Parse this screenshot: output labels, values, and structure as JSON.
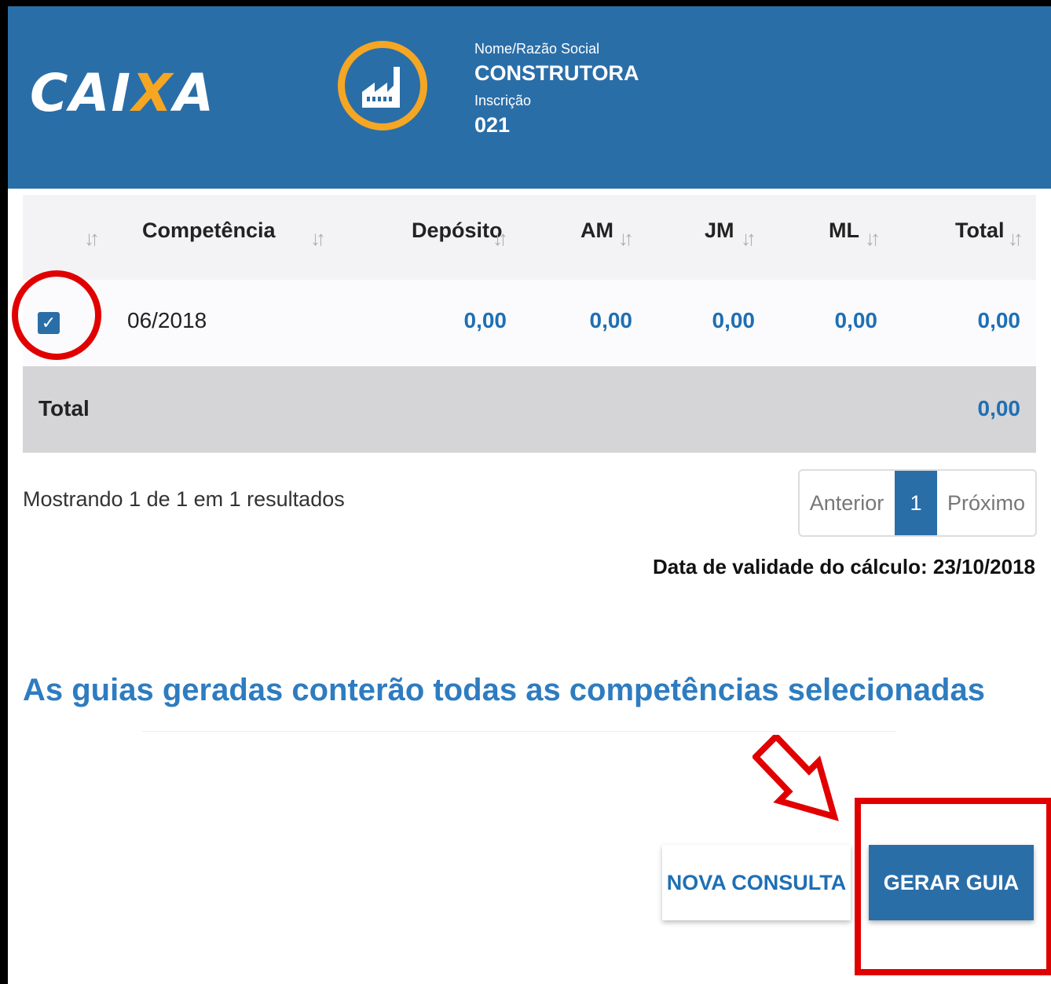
{
  "header": {
    "logo_part1": "CAI",
    "logo_x": "X",
    "logo_part2": "A",
    "name_label": "Nome/Razão Social",
    "name_value": "CONSTRUTORA",
    "inscricao_label": "Inscrição",
    "inscricao_value": "021"
  },
  "table": {
    "columns": [
      "Competência",
      "Depósito",
      "AM",
      "JM",
      "ML",
      "Total"
    ],
    "rows": [
      {
        "selected": true,
        "competencia": "06/2018",
        "deposito": "0,00",
        "am": "0,00",
        "jm": "0,00",
        "ml": "0,00",
        "total": "0,00"
      }
    ],
    "total_label": "Total",
    "total_value": "0,00"
  },
  "pagination": {
    "summary": "Mostrando 1 de 1 em 1 resultados",
    "prev": "Anterior",
    "current": "1",
    "next": "Próximo"
  },
  "validity": "Data de validade do cálculo: 23/10/2018",
  "headline": "As guias geradas conterão todas as competências selecionadas",
  "buttons": {
    "nova_consulta": "NOVA CONSULTA",
    "gerar_guia": "GERAR GUIA"
  },
  "colors": {
    "brand_blue": "#2a6ea8",
    "brand_orange": "#f5a623",
    "value_blue": "#1f6fb4",
    "annotation_red": "#e10000"
  }
}
